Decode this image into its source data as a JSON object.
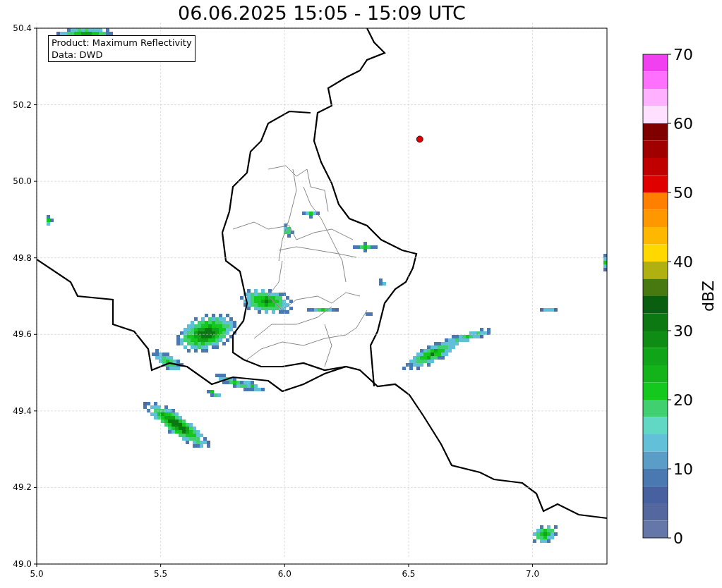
{
  "title": "06.06.2025 15:05 - 15:09 UTC",
  "info_box": {
    "lines": [
      "Product: Maximum Reflectivity",
      "Data: DWD"
    ]
  },
  "map": {
    "chart_data": {
      "type": "scatter",
      "xlim": [
        5,
        7.3
      ],
      "ylim": [
        49,
        50.4
      ],
      "xticks": [
        {
          "value": 5,
          "label": "5.0"
        },
        {
          "value": 5.5,
          "label": "5.5"
        },
        {
          "value": 6,
          "label": "6.0"
        },
        {
          "value": 6.5,
          "label": "6.5"
        },
        {
          "value": 7,
          "label": "7.0"
        }
      ],
      "yticks": [
        {
          "value": 49,
          "label": "49.0"
        },
        {
          "value": 49.2,
          "label": "49.2"
        },
        {
          "value": 49.4,
          "label": "49.4"
        },
        {
          "value": 49.6,
          "label": "49.6"
        },
        {
          "value": 49.8,
          "label": "49.8"
        },
        {
          "value": 50,
          "label": "50.0"
        },
        {
          "value": 50.2,
          "label": "50.2"
        },
        {
          "value": 50.4,
          "label": "50.4"
        }
      ],
      "x": [
        6.545
      ],
      "grid": true,
      "series": [
        {
          "color": "#e00000",
          "values": [
            50.11
          ]
        }
      ]
    }
  },
  "colorbar": {
    "label": "dBZ",
    "ticks": [
      "70",
      "60",
      "50",
      "40",
      "30",
      "20",
      "10",
      "0"
    ],
    "segments": [
      {
        "color": "#f040f0"
      },
      {
        "color": "#ff70ff"
      },
      {
        "color": "#ffb0ff"
      },
      {
        "color": "#ffe0ff"
      },
      {
        "color": "#800000"
      },
      {
        "color": "#a00000"
      },
      {
        "color": "#c00000"
      },
      {
        "color": "#e00000"
      },
      {
        "color": "#ff8000"
      },
      {
        "color": "#ff9800"
      },
      {
        "color": "#ffb800"
      },
      {
        "color": "#ffd800"
      },
      {
        "color": "#b0b010"
      },
      {
        "color": "#487810"
      },
      {
        "color": "#0a5e10"
      },
      {
        "color": "#0c7812"
      },
      {
        "color": "#0e8c14"
      },
      {
        "color": "#10a418"
      },
      {
        "color": "#12b41a"
      },
      {
        "color": "#14c81e"
      },
      {
        "color": "#40d070"
      },
      {
        "color": "#60d8c4"
      },
      {
        "color": "#62c0d8"
      },
      {
        "color": "#5a9ec8"
      },
      {
        "color": "#4a78b0"
      },
      {
        "color": "#4660a0"
      },
      {
        "color": "#55679f"
      },
      {
        "color": "#6477a8"
      }
    ]
  }
}
